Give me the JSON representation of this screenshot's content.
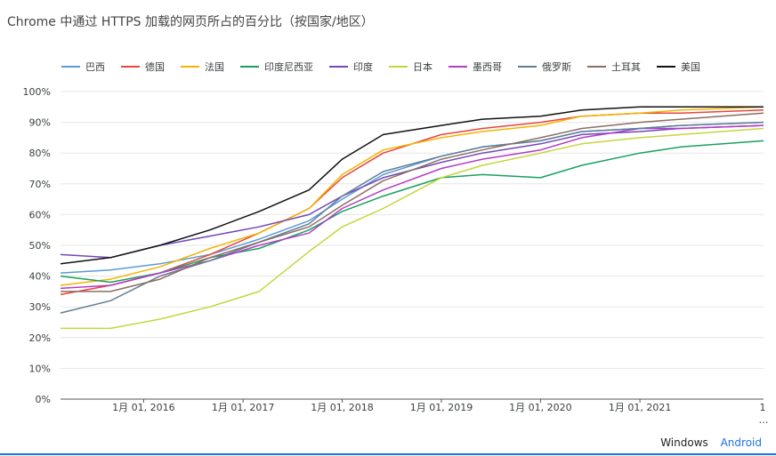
{
  "title": "Chrome 中通过 HTTPS 加载的网页所占的百分比（按国家/地区）",
  "tabs": {
    "windows": "Windows",
    "android": "Android",
    "selected": "android"
  },
  "truncated_tick": "1",
  "overflow_marker": "…",
  "chart_data": {
    "type": "line",
    "title": "Chrome 中通过 HTTPS 加载的网页所占的百分比（按国家/地区）",
    "xlabel": "",
    "ylabel": "",
    "x_range": [
      "2015-03-01",
      "2022-04-01"
    ],
    "ylim": [
      0,
      100
    ],
    "y_ticks": [
      "0%",
      "10%",
      "20%",
      "30%",
      "40%",
      "50%",
      "60%",
      "70%",
      "80%",
      "90%",
      "100%"
    ],
    "x_ticks": [
      {
        "date": "2016-01-01",
        "label": "1月 01, 2016"
      },
      {
        "date": "2017-01-01",
        "label": "1月 01, 2017"
      },
      {
        "date": "2018-01-01",
        "label": "1月 01, 2018"
      },
      {
        "date": "2019-01-01",
        "label": "1月 01, 2019"
      },
      {
        "date": "2020-01-01",
        "label": "1月 01, 2020"
      },
      {
        "date": "2021-01-01",
        "label": "1月 01, 2021"
      }
    ],
    "grid": "horizontal",
    "legend_position": "top",
    "series": [
      {
        "name": "巴西",
        "color": "#5b9bd5",
        "points": [
          [
            "2015-03-01",
            41
          ],
          [
            "2015-09-01",
            42
          ],
          [
            "2016-03-01",
            44
          ],
          [
            "2016-09-01",
            47
          ],
          [
            "2017-03-01",
            52
          ],
          [
            "2017-09-01",
            58
          ],
          [
            "2018-01-01",
            65
          ],
          [
            "2018-06-01",
            73
          ],
          [
            "2019-01-01",
            79
          ],
          [
            "2019-06-01",
            82
          ],
          [
            "2020-01-01",
            84
          ],
          [
            "2020-06-01",
            87
          ],
          [
            "2021-01-01",
            88
          ],
          [
            "2021-06-01",
            89
          ],
          [
            "2022-04-01",
            90
          ]
        ]
      },
      {
        "name": "德国",
        "color": "#e8453c",
        "points": [
          [
            "2015-03-01",
            34
          ],
          [
            "2015-09-01",
            37
          ],
          [
            "2016-03-01",
            41
          ],
          [
            "2016-09-01",
            47
          ],
          [
            "2017-03-01",
            54
          ],
          [
            "2017-09-01",
            62
          ],
          [
            "2018-01-01",
            72
          ],
          [
            "2018-06-01",
            80
          ],
          [
            "2019-01-01",
            86
          ],
          [
            "2019-06-01",
            88
          ],
          [
            "2020-01-01",
            90
          ],
          [
            "2020-06-01",
            92
          ],
          [
            "2021-01-01",
            93
          ],
          [
            "2021-06-01",
            93
          ],
          [
            "2022-04-01",
            94
          ]
        ]
      },
      {
        "name": "法国",
        "color": "#f4b400",
        "points": [
          [
            "2015-03-01",
            37
          ],
          [
            "2015-09-01",
            39
          ],
          [
            "2016-03-01",
            43
          ],
          [
            "2016-09-01",
            49
          ],
          [
            "2017-03-01",
            54
          ],
          [
            "2017-09-01",
            62
          ],
          [
            "2018-01-01",
            73
          ],
          [
            "2018-06-01",
            81
          ],
          [
            "2019-01-01",
            85
          ],
          [
            "2019-06-01",
            87
          ],
          [
            "2020-01-01",
            89
          ],
          [
            "2020-06-01",
            92
          ],
          [
            "2021-01-01",
            93
          ],
          [
            "2021-06-01",
            94
          ],
          [
            "2022-04-01",
            95
          ]
        ]
      },
      {
        "name": "印度尼西亚",
        "color": "#18a05e",
        "points": [
          [
            "2015-03-01",
            40
          ],
          [
            "2015-09-01",
            38
          ],
          [
            "2016-03-01",
            41
          ],
          [
            "2016-09-01",
            46
          ],
          [
            "2017-03-01",
            49
          ],
          [
            "2017-09-01",
            55
          ],
          [
            "2018-01-01",
            61
          ],
          [
            "2018-06-01",
            66
          ],
          [
            "2019-01-01",
            72
          ],
          [
            "2019-06-01",
            73
          ],
          [
            "2020-01-01",
            72
          ],
          [
            "2020-06-01",
            76
          ],
          [
            "2021-01-01",
            80
          ],
          [
            "2021-06-01",
            82
          ],
          [
            "2022-04-01",
            84
          ]
        ]
      },
      {
        "name": "印度",
        "color": "#7248b9",
        "points": [
          [
            "2015-03-01",
            47
          ],
          [
            "2015-09-01",
            46
          ],
          [
            "2016-03-01",
            50
          ],
          [
            "2016-09-01",
            53
          ],
          [
            "2017-03-01",
            56
          ],
          [
            "2017-09-01",
            60
          ],
          [
            "2018-01-01",
            66
          ],
          [
            "2018-06-01",
            72
          ],
          [
            "2019-01-01",
            77
          ],
          [
            "2019-06-01",
            80
          ],
          [
            "2020-01-01",
            83
          ],
          [
            "2020-06-01",
            86
          ],
          [
            "2021-01-01",
            87
          ],
          [
            "2021-06-01",
            88
          ],
          [
            "2022-04-01",
            89
          ]
        ]
      },
      {
        "name": "日本",
        "color": "#c5d63c",
        "points": [
          [
            "2015-03-01",
            23
          ],
          [
            "2015-09-01",
            23
          ],
          [
            "2016-03-01",
            26
          ],
          [
            "2016-09-01",
            30
          ],
          [
            "2017-03-01",
            35
          ],
          [
            "2017-09-01",
            48
          ],
          [
            "2018-01-01",
            56
          ],
          [
            "2018-06-01",
            62
          ],
          [
            "2019-01-01",
            72
          ],
          [
            "2019-06-01",
            76
          ],
          [
            "2020-01-01",
            80
          ],
          [
            "2020-06-01",
            83
          ],
          [
            "2021-01-01",
            85
          ],
          [
            "2021-06-01",
            86
          ],
          [
            "2022-04-01",
            88
          ]
        ]
      },
      {
        "name": "墨西哥",
        "color": "#b43cc8",
        "points": [
          [
            "2015-03-01",
            36
          ],
          [
            "2015-09-01",
            37
          ],
          [
            "2016-03-01",
            41
          ],
          [
            "2016-09-01",
            45
          ],
          [
            "2017-03-01",
            50
          ],
          [
            "2017-09-01",
            54
          ],
          [
            "2018-01-01",
            62
          ],
          [
            "2018-06-01",
            68
          ],
          [
            "2019-01-01",
            75
          ],
          [
            "2019-06-01",
            78
          ],
          [
            "2020-01-01",
            81
          ],
          [
            "2020-06-01",
            85
          ],
          [
            "2021-01-01",
            88
          ],
          [
            "2021-06-01",
            88
          ],
          [
            "2022-04-01",
            89
          ]
        ]
      },
      {
        "name": "俄罗斯",
        "color": "#5f7d95",
        "points": [
          [
            "2015-03-01",
            28
          ],
          [
            "2015-09-01",
            32
          ],
          [
            "2016-03-01",
            40
          ],
          [
            "2016-09-01",
            45
          ],
          [
            "2017-03-01",
            51
          ],
          [
            "2017-09-01",
            57
          ],
          [
            "2018-01-01",
            66
          ],
          [
            "2018-06-01",
            74
          ],
          [
            "2019-01-01",
            79
          ],
          [
            "2019-06-01",
            82
          ],
          [
            "2020-01-01",
            84
          ],
          [
            "2020-06-01",
            87
          ],
          [
            "2021-01-01",
            88
          ],
          [
            "2021-06-01",
            89
          ],
          [
            "2022-04-01",
            90
          ]
        ]
      },
      {
        "name": "土耳其",
        "color": "#8d6e63",
        "points": [
          [
            "2015-03-01",
            35
          ],
          [
            "2015-09-01",
            35
          ],
          [
            "2016-03-01",
            39
          ],
          [
            "2016-09-01",
            46
          ],
          [
            "2017-03-01",
            51
          ],
          [
            "2017-09-01",
            56
          ],
          [
            "2018-01-01",
            63
          ],
          [
            "2018-06-01",
            71
          ],
          [
            "2019-01-01",
            78
          ],
          [
            "2019-06-01",
            81
          ],
          [
            "2020-01-01",
            85
          ],
          [
            "2020-06-01",
            88
          ],
          [
            "2021-01-01",
            90
          ],
          [
            "2021-06-01",
            91
          ],
          [
            "2022-04-01",
            93
          ]
        ]
      },
      {
        "name": "美国",
        "color": "#111111",
        "points": [
          [
            "2015-03-01",
            44
          ],
          [
            "2015-09-01",
            46
          ],
          [
            "2016-03-01",
            50
          ],
          [
            "2016-09-01",
            55
          ],
          [
            "2017-03-01",
            61
          ],
          [
            "2017-09-01",
            68
          ],
          [
            "2018-01-01",
            78
          ],
          [
            "2018-06-01",
            86
          ],
          [
            "2019-01-01",
            89
          ],
          [
            "2019-06-01",
            91
          ],
          [
            "2020-01-01",
            92
          ],
          [
            "2020-06-01",
            94
          ],
          [
            "2021-01-01",
            95
          ],
          [
            "2021-06-01",
            95
          ],
          [
            "2022-04-01",
            95
          ]
        ]
      }
    ]
  }
}
